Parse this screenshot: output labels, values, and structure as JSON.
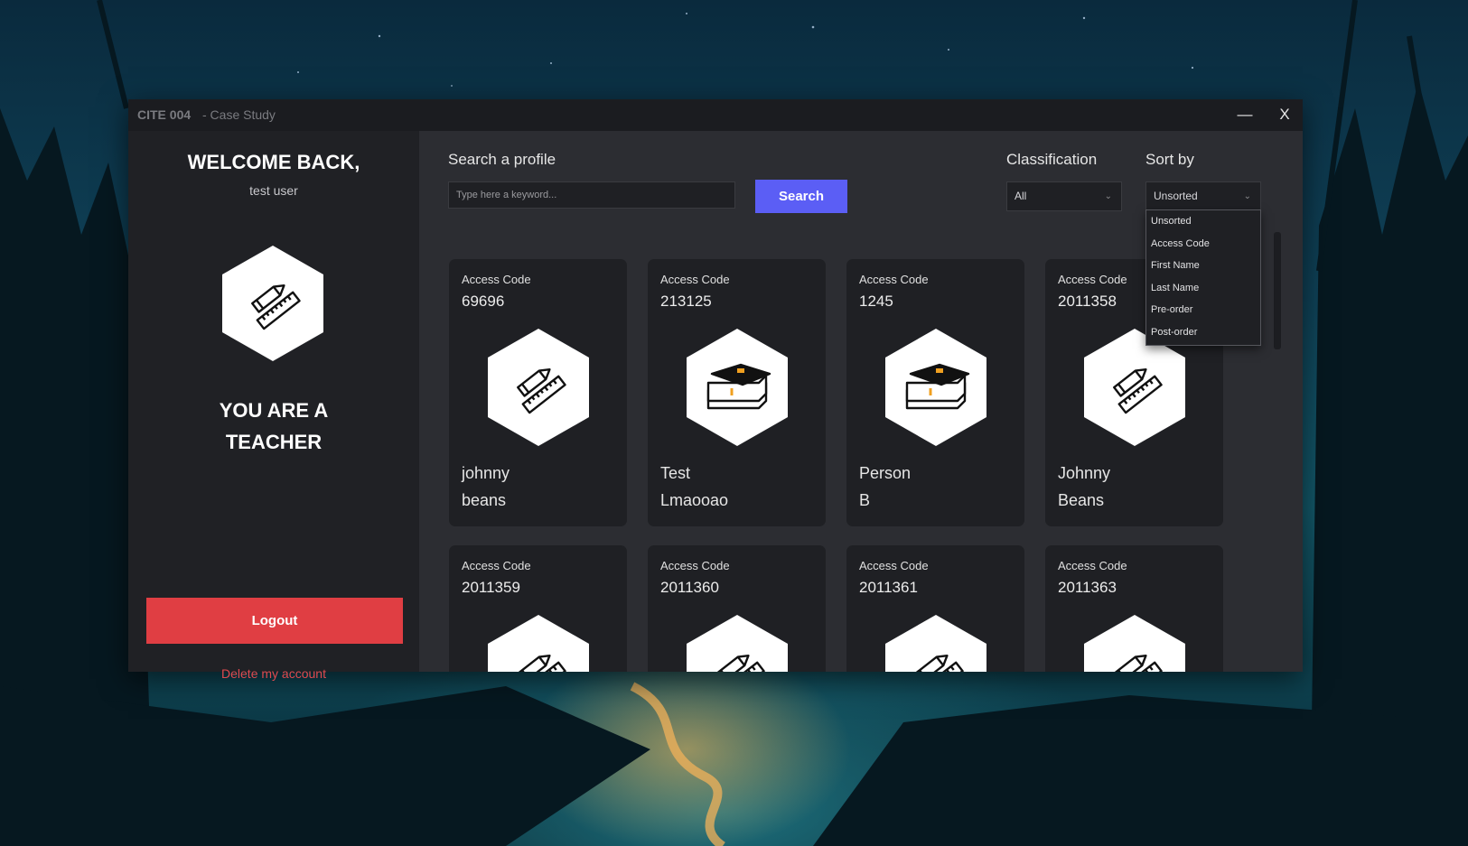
{
  "window": {
    "app_name": "CITE 004",
    "subtitle": "- Case Study",
    "minimize_label": "—",
    "close_label": "X"
  },
  "sidebar": {
    "welcome": "WELCOME BACK,",
    "username": "test user",
    "avatar_icon": "pencil-ruler-icon",
    "role_line1": "YOU ARE A",
    "role_line2": "TEACHER",
    "logout_label": "Logout",
    "delete_label": "Delete my account"
  },
  "search": {
    "label": "Search a profile",
    "placeholder": "Type here a keyword...",
    "value": "",
    "button_label": "Search"
  },
  "classification": {
    "label": "Classification",
    "selected": "All"
  },
  "sort": {
    "label": "Sort by",
    "selected": "Unsorted",
    "options": [
      "Unsorted",
      "Access Code",
      "First Name",
      "Last Name",
      "Pre-order",
      "Post-order"
    ]
  },
  "profiles": [
    {
      "access_label": "Access Code",
      "code": "69696",
      "first": "johnny",
      "last": "beans",
      "icon": "pencil-ruler-icon"
    },
    {
      "access_label": "Access Code",
      "code": "213125",
      "first": "Test",
      "last": "Lmaooao",
      "icon": "books-icon"
    },
    {
      "access_label": "Access Code",
      "code": "1245",
      "first": "Person",
      "last": "B",
      "icon": "books-icon"
    },
    {
      "access_label": "Access Code",
      "code": "2011358",
      "first": "Johnny",
      "last": "Beans",
      "icon": "pencil-ruler-icon"
    },
    {
      "access_label": "Access Code",
      "code": "2011359",
      "first": "",
      "last": "",
      "icon": "pencil-ruler-icon"
    },
    {
      "access_label": "Access Code",
      "code": "2011360",
      "first": "",
      "last": "",
      "icon": "pencil-ruler-icon"
    },
    {
      "access_label": "Access Code",
      "code": "2011361",
      "first": "",
      "last": "",
      "icon": "pencil-ruler-icon"
    },
    {
      "access_label": "Access Code",
      "code": "2011363",
      "first": "",
      "last": "",
      "icon": "pencil-ruler-icon"
    }
  ],
  "colors": {
    "accent": "#5b5ef5",
    "danger": "#e03e43",
    "panel": "#202125",
    "main": "#2c2d32",
    "card": "#1f2024"
  }
}
